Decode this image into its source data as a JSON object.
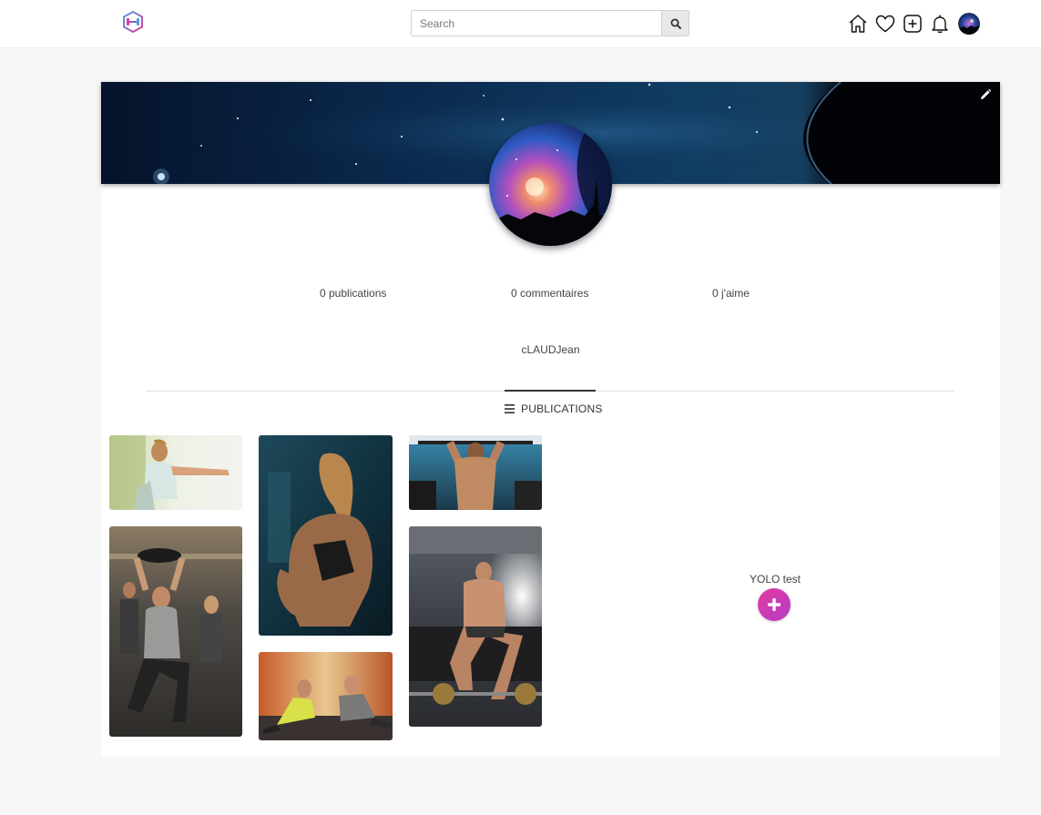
{
  "nav": {
    "search_placeholder": "Search",
    "icons": [
      "home-icon",
      "heart-icon",
      "add-square-icon",
      "bell-icon",
      "avatar"
    ]
  },
  "profile": {
    "stats": {
      "publications": "0 publications",
      "comments": "0 commentaires",
      "likes": "0 j'aime"
    },
    "username": "cLAUDJean"
  },
  "tabs": {
    "publications": "PUBLICATIONS"
  },
  "feed": {
    "photos": [
      {
        "name": "woman-squat-outdoor"
      },
      {
        "name": "group-fitness-class"
      },
      {
        "name": "woman-back-gym"
      },
      {
        "name": "couple-pushups"
      },
      {
        "name": "man-back-pulldown"
      },
      {
        "name": "man-bodybuilder-bench"
      }
    ]
  },
  "create": {
    "label": "YOLO test"
  },
  "colors": {
    "accent_start": "#e23aa0",
    "accent_end": "#b43cc8",
    "nav_bg": "#ffffff",
    "page_bg": "#f7f7f7"
  }
}
